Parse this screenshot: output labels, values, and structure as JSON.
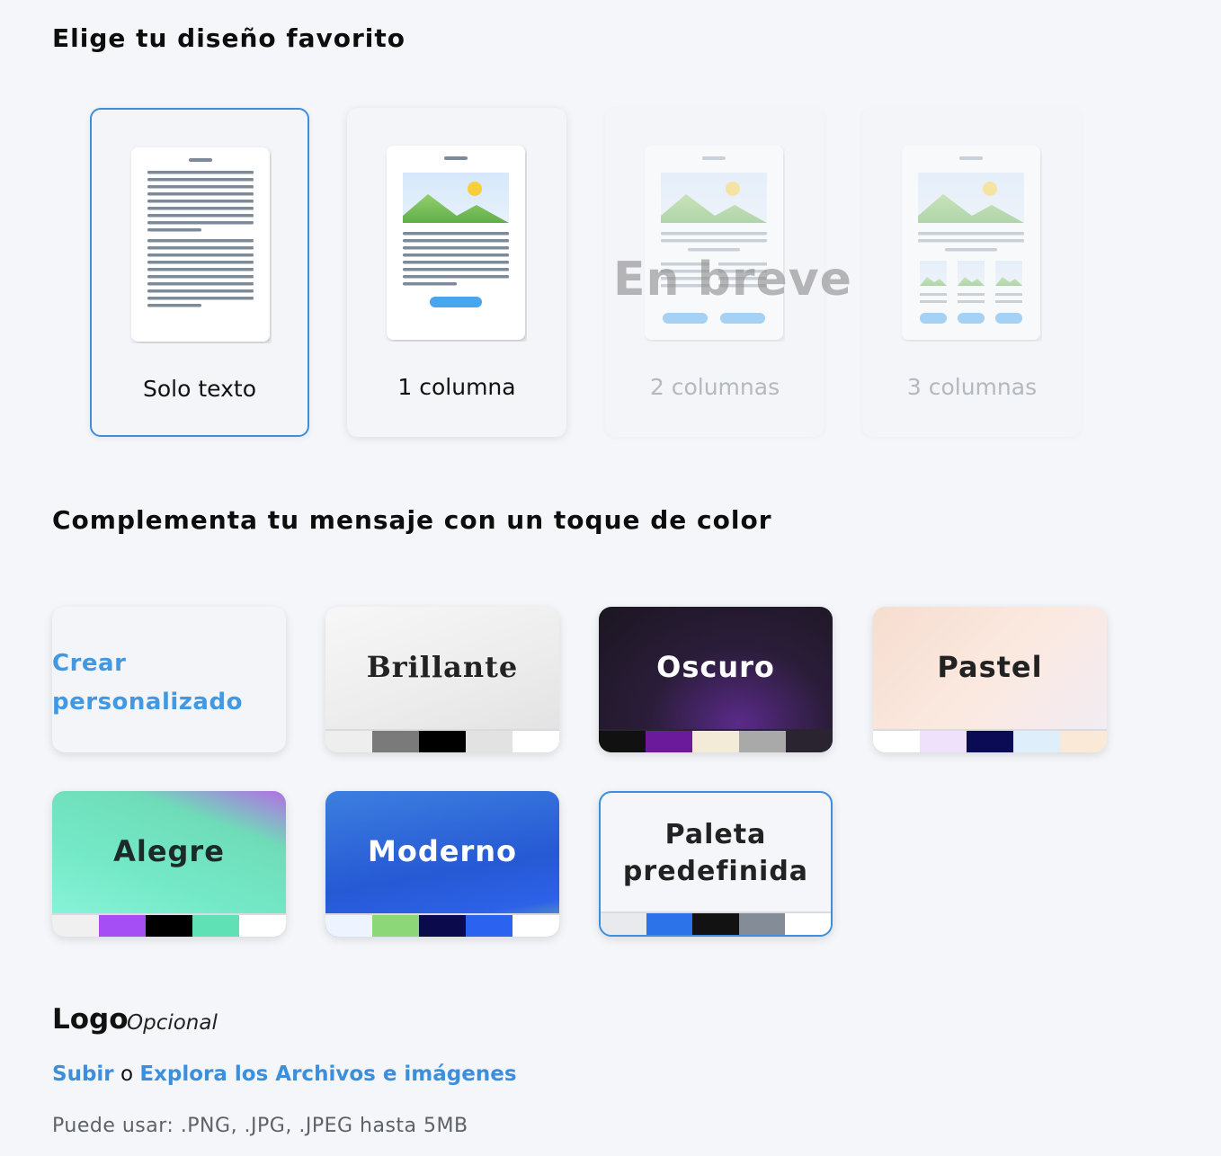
{
  "layout_section": {
    "title": "Elige tu diseño favorito",
    "options": [
      {
        "label": "Solo texto",
        "state": "selected"
      },
      {
        "label": "1 columna",
        "state": "available"
      },
      {
        "label": "2 columnas",
        "state": "disabled"
      },
      {
        "label": "3 columnas",
        "state": "disabled"
      }
    ],
    "coming_soon": "En breve"
  },
  "color_section": {
    "title": "Complementa tu mensaje con un toque de color",
    "custom": {
      "line1": "Crear",
      "line2": "personalizado"
    },
    "palettes": [
      {
        "name": "Brillante",
        "swatches": [
          "#eeeeee",
          "#7a7a7a",
          "#000000",
          "#e2e2e2",
          "#ffffff"
        ]
      },
      {
        "name": "Oscuro",
        "swatches": [
          "#111111",
          "#6b1a9c",
          "#f4ead8",
          "#a9a9a9",
          "#2a2430"
        ]
      },
      {
        "name": "Pastel",
        "swatches": [
          "#ffffff",
          "#efe0fb",
          "#0b0a55",
          "#dfeefb",
          "#fbe9d8"
        ]
      },
      {
        "name": "Alegre",
        "swatches": [
          "#f0f0f0",
          "#a64ef5",
          "#000000",
          "#5fe0b5",
          "#ffffff"
        ]
      },
      {
        "name": "Moderno",
        "swatches": [
          "#eef4ff",
          "#8cd777",
          "#0a0a4d",
          "#2b63f0",
          "#ffffff"
        ]
      },
      {
        "name": "Paleta predefinida",
        "line1": "Paleta",
        "line2": "predefinida",
        "selected": true,
        "swatches": [
          "#e8eaee",
          "#2c72e8",
          "#121212",
          "#848c97",
          "#ffffff"
        ]
      }
    ]
  },
  "logo_section": {
    "title": "Logo",
    "optional": "Opcional",
    "upload_link": "Subir",
    "or": "o",
    "explore_link": "Explora los Archivos e imágenes",
    "hint": "Puede usar: .PNG, .JPG, .JPEG hasta 5MB"
  },
  "colors": {
    "accent": "#3b8fdc",
    "link": "#4299e1",
    "background": "#f4f6fa"
  }
}
